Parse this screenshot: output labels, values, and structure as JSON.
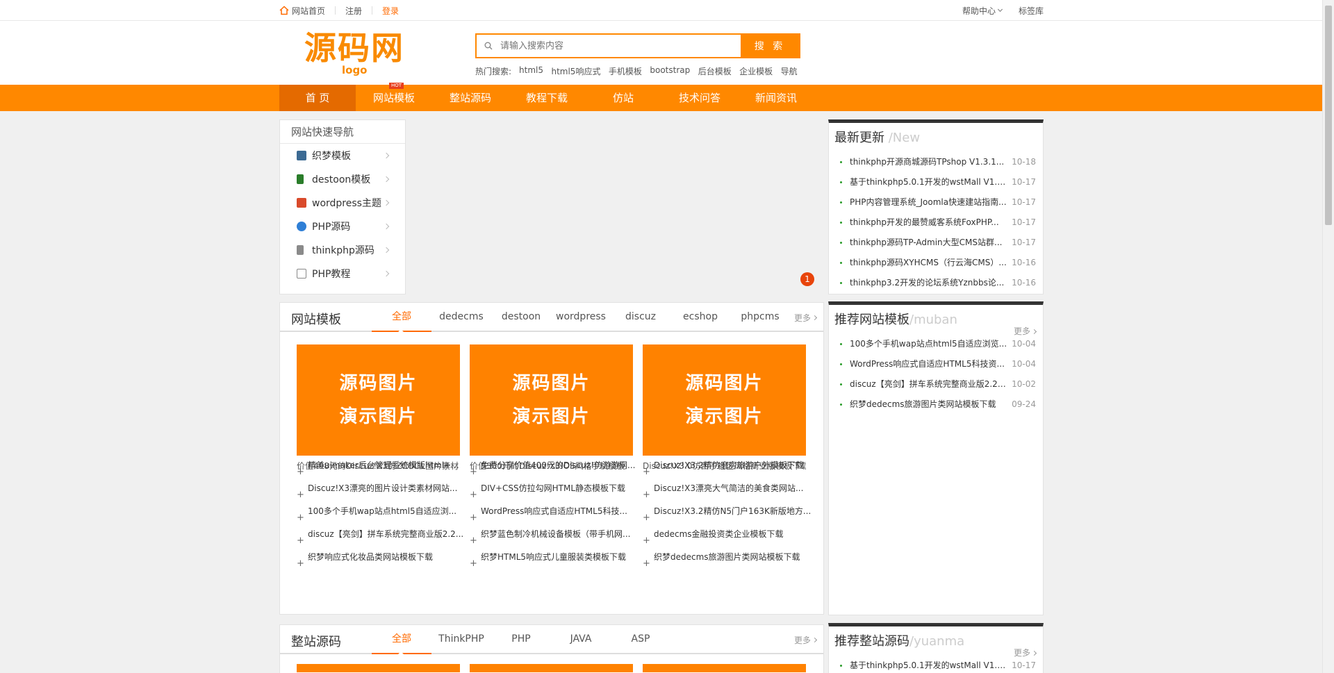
{
  "topbar": {
    "home": "网站首页",
    "register": "注册",
    "login": "登录",
    "help": "帮助中心",
    "tags": "标签库"
  },
  "header": {
    "logo_main": "源码网",
    "logo_sub": "logo",
    "search_placeholder": "请输入搜索内容",
    "search_button": "搜 索",
    "hot_label": "热门搜索:",
    "hot_words": [
      "html5",
      "html5响应式",
      "手机模板",
      "bootstrap",
      "后台模板",
      "企业模板",
      "导航"
    ]
  },
  "nav": {
    "items": [
      "首 页",
      "网站模板",
      "整站源码",
      "教程下载",
      "仿站",
      "技术问答",
      "新闻资讯"
    ],
    "hot_badge": "HOT"
  },
  "quicknav": {
    "title": "网站快速导航",
    "items": [
      "织梦模板",
      "destoon模板",
      "wordpress主题",
      "PHP源码",
      "thinkphp源码",
      "PHP教程"
    ]
  },
  "banner_badge": "1",
  "templates": {
    "title": "网站模板",
    "tabs": [
      "全部",
      "dedecms",
      "destoon",
      "wordpress",
      "discuz",
      "ecshop",
      "phpcms"
    ],
    "more": "更多",
    "thumb_line1": "源码图片",
    "thumb_line2": "演示图片",
    "captions": [
      "价值498元的Discuz!X3仿ZCOOL图片素材",
      "价值300元的Discuz!X3IOS风格手机模板",
      "Discuz!X3.0仿西子社区风格商业版模板下载"
    ],
    "lists": [
      [
        "精美uimaker后台管理系统模版html+...",
        "Discuz!X3漂亮的图片设计类素材网站...",
        "100多个手机wap站点html5自适应浏...",
        "discuz【亮剑】拼车系统完整商业版2.2...",
        "织梦响应式化妆品类网站模板下载"
      ],
      [
        "免费分享价值400元的Discuz!仿游游网...",
        "DIV+CSS仿拉勾网HTML静态模板下载",
        "WordPress响应式自适应HTML5科技...",
        "织梦蓝色制冷机械设备模板（带手机网...",
        "织梦HTML5响应式儿童服装类模板下载"
      ],
      [
        "Discuz!X3.2精仿磨房旅游户外模板下载",
        "Discuz!X3漂亮大气简洁的美食类网站...",
        "Discuz!X3.2精仿N5门户163K新版地方...",
        "dedecms金融投资类企业模板下载",
        "织梦dedecms旅游图片类网站模板下载"
      ]
    ]
  },
  "source": {
    "title": "整站源码",
    "tabs": [
      "全部",
      "ThinkPHP",
      "PHP",
      "JAVA",
      "ASP"
    ],
    "more": "更多"
  },
  "latest": {
    "title": "最新更新",
    "en": "/New",
    "items": [
      {
        "text": "thinkphp开源商城源码TPshop V1.3.1...",
        "date": "10-18"
      },
      {
        "text": "基于thinkphp5.0.1开发的wstMall V1.7....",
        "date": "10-17"
      },
      {
        "text": "PHP内容管理系统_Joomla快速建站指南...",
        "date": "10-17"
      },
      {
        "text": "thinkphp开发的最赞威客系统FoxPHP...",
        "date": "10-17"
      },
      {
        "text": "thinkphp源码TP-Admin大型CMS站群...",
        "date": "10-17"
      },
      {
        "text": "thinkphp源码XYHCMS（行云海CMS）...",
        "date": "10-16"
      },
      {
        "text": "thinkphp3.2开发的论坛系统Yznbbs论...",
        "date": "10-16"
      }
    ]
  },
  "rec_templates": {
    "title": "推荐网站模板",
    "en": "/muban",
    "more": "更多",
    "items": [
      {
        "text": "100多个手机wap站点html5自适应浏览...",
        "date": "10-04"
      },
      {
        "text": "WordPress响应式自适应HTML5科技资...",
        "date": "10-04"
      },
      {
        "text": "discuz【亮剑】拼车系统完整商业版2.2....",
        "date": "10-02"
      },
      {
        "text": "织梦dedecms旅游图片类网站模板下载",
        "date": "09-24"
      }
    ]
  },
  "rec_source": {
    "title": "推荐整站源码",
    "en": "/yuanma",
    "more": "更多",
    "items": [
      {
        "text": "基于thinkphp5.0.1开发的wstMall V1.7....",
        "date": "10-17"
      }
    ]
  }
}
